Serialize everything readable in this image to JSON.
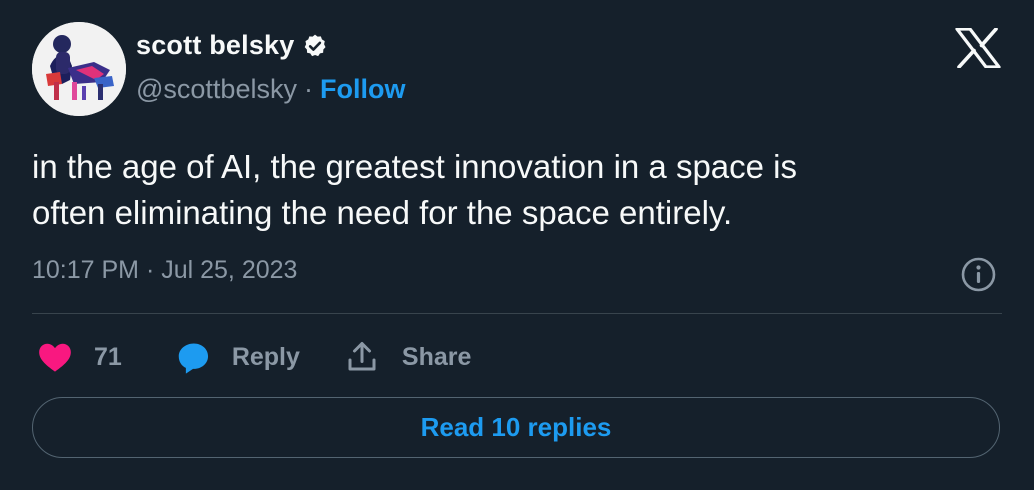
{
  "author": {
    "display_name": "scott belsky",
    "handle": "@scottbelsky",
    "separator": "·",
    "follow_label": "Follow",
    "verified": true
  },
  "tweet": {
    "lines": [
      "in the age of AI, the greatest innovation in a space is",
      "often eliminating the need for the space entirely."
    ],
    "timestamp": "10:17 PM · Jul 25, 2023"
  },
  "actions": {
    "like_count": "71",
    "reply_label": "Reply",
    "share_label": "Share"
  },
  "read_replies_label": "Read 10 replies",
  "icons": {
    "logo": "x-logo-icon",
    "verified": "verified-badge-icon",
    "info": "info-icon",
    "like": "heart-icon",
    "reply": "speech-bubble-icon",
    "share": "share-icon"
  },
  "colors": {
    "background": "#15202b",
    "accent": "#1d9bf0",
    "like": "#f91880",
    "muted": "#8b98a5",
    "text": "#f7f9f9",
    "border": "#38444d"
  }
}
